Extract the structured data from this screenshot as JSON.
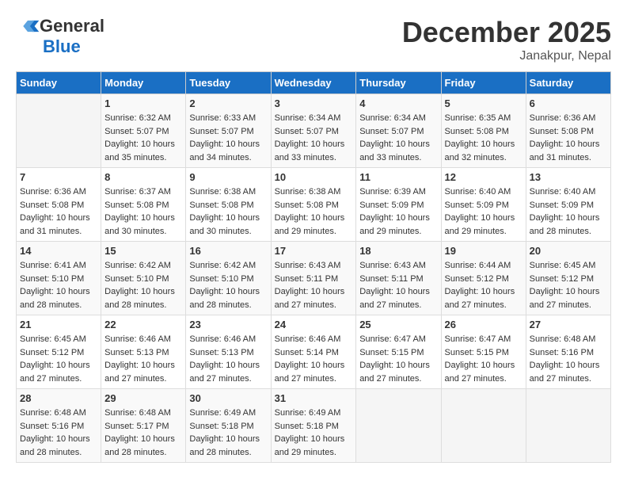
{
  "header": {
    "logo_general": "General",
    "logo_blue": "Blue",
    "title": "December 2025",
    "location": "Janakpur, Nepal"
  },
  "calendar": {
    "days_of_week": [
      "Sunday",
      "Monday",
      "Tuesday",
      "Wednesday",
      "Thursday",
      "Friday",
      "Saturday"
    ],
    "weeks": [
      [
        {
          "day": "",
          "info": ""
        },
        {
          "day": "1",
          "info": "Sunrise: 6:32 AM\nSunset: 5:07 PM\nDaylight: 10 hours\nand 35 minutes."
        },
        {
          "day": "2",
          "info": "Sunrise: 6:33 AM\nSunset: 5:07 PM\nDaylight: 10 hours\nand 34 minutes."
        },
        {
          "day": "3",
          "info": "Sunrise: 6:34 AM\nSunset: 5:07 PM\nDaylight: 10 hours\nand 33 minutes."
        },
        {
          "day": "4",
          "info": "Sunrise: 6:34 AM\nSunset: 5:07 PM\nDaylight: 10 hours\nand 33 minutes."
        },
        {
          "day": "5",
          "info": "Sunrise: 6:35 AM\nSunset: 5:08 PM\nDaylight: 10 hours\nand 32 minutes."
        },
        {
          "day": "6",
          "info": "Sunrise: 6:36 AM\nSunset: 5:08 PM\nDaylight: 10 hours\nand 31 minutes."
        }
      ],
      [
        {
          "day": "7",
          "info": "Sunrise: 6:36 AM\nSunset: 5:08 PM\nDaylight: 10 hours\nand 31 minutes."
        },
        {
          "day": "8",
          "info": "Sunrise: 6:37 AM\nSunset: 5:08 PM\nDaylight: 10 hours\nand 30 minutes."
        },
        {
          "day": "9",
          "info": "Sunrise: 6:38 AM\nSunset: 5:08 PM\nDaylight: 10 hours\nand 30 minutes."
        },
        {
          "day": "10",
          "info": "Sunrise: 6:38 AM\nSunset: 5:08 PM\nDaylight: 10 hours\nand 29 minutes."
        },
        {
          "day": "11",
          "info": "Sunrise: 6:39 AM\nSunset: 5:09 PM\nDaylight: 10 hours\nand 29 minutes."
        },
        {
          "day": "12",
          "info": "Sunrise: 6:40 AM\nSunset: 5:09 PM\nDaylight: 10 hours\nand 29 minutes."
        },
        {
          "day": "13",
          "info": "Sunrise: 6:40 AM\nSunset: 5:09 PM\nDaylight: 10 hours\nand 28 minutes."
        }
      ],
      [
        {
          "day": "14",
          "info": "Sunrise: 6:41 AM\nSunset: 5:10 PM\nDaylight: 10 hours\nand 28 minutes."
        },
        {
          "day": "15",
          "info": "Sunrise: 6:42 AM\nSunset: 5:10 PM\nDaylight: 10 hours\nand 28 minutes."
        },
        {
          "day": "16",
          "info": "Sunrise: 6:42 AM\nSunset: 5:10 PM\nDaylight: 10 hours\nand 28 minutes."
        },
        {
          "day": "17",
          "info": "Sunrise: 6:43 AM\nSunset: 5:11 PM\nDaylight: 10 hours\nand 27 minutes."
        },
        {
          "day": "18",
          "info": "Sunrise: 6:43 AM\nSunset: 5:11 PM\nDaylight: 10 hours\nand 27 minutes."
        },
        {
          "day": "19",
          "info": "Sunrise: 6:44 AM\nSunset: 5:12 PM\nDaylight: 10 hours\nand 27 minutes."
        },
        {
          "day": "20",
          "info": "Sunrise: 6:45 AM\nSunset: 5:12 PM\nDaylight: 10 hours\nand 27 minutes."
        }
      ],
      [
        {
          "day": "21",
          "info": "Sunrise: 6:45 AM\nSunset: 5:12 PM\nDaylight: 10 hours\nand 27 minutes."
        },
        {
          "day": "22",
          "info": "Sunrise: 6:46 AM\nSunset: 5:13 PM\nDaylight: 10 hours\nand 27 minutes."
        },
        {
          "day": "23",
          "info": "Sunrise: 6:46 AM\nSunset: 5:13 PM\nDaylight: 10 hours\nand 27 minutes."
        },
        {
          "day": "24",
          "info": "Sunrise: 6:46 AM\nSunset: 5:14 PM\nDaylight: 10 hours\nand 27 minutes."
        },
        {
          "day": "25",
          "info": "Sunrise: 6:47 AM\nSunset: 5:15 PM\nDaylight: 10 hours\nand 27 minutes."
        },
        {
          "day": "26",
          "info": "Sunrise: 6:47 AM\nSunset: 5:15 PM\nDaylight: 10 hours\nand 27 minutes."
        },
        {
          "day": "27",
          "info": "Sunrise: 6:48 AM\nSunset: 5:16 PM\nDaylight: 10 hours\nand 27 minutes."
        }
      ],
      [
        {
          "day": "28",
          "info": "Sunrise: 6:48 AM\nSunset: 5:16 PM\nDaylight: 10 hours\nand 28 minutes."
        },
        {
          "day": "29",
          "info": "Sunrise: 6:48 AM\nSunset: 5:17 PM\nDaylight: 10 hours\nand 28 minutes."
        },
        {
          "day": "30",
          "info": "Sunrise: 6:49 AM\nSunset: 5:18 PM\nDaylight: 10 hours\nand 28 minutes."
        },
        {
          "day": "31",
          "info": "Sunrise: 6:49 AM\nSunset: 5:18 PM\nDaylight: 10 hours\nand 29 minutes."
        },
        {
          "day": "",
          "info": ""
        },
        {
          "day": "",
          "info": ""
        },
        {
          "day": "",
          "info": ""
        }
      ]
    ]
  }
}
